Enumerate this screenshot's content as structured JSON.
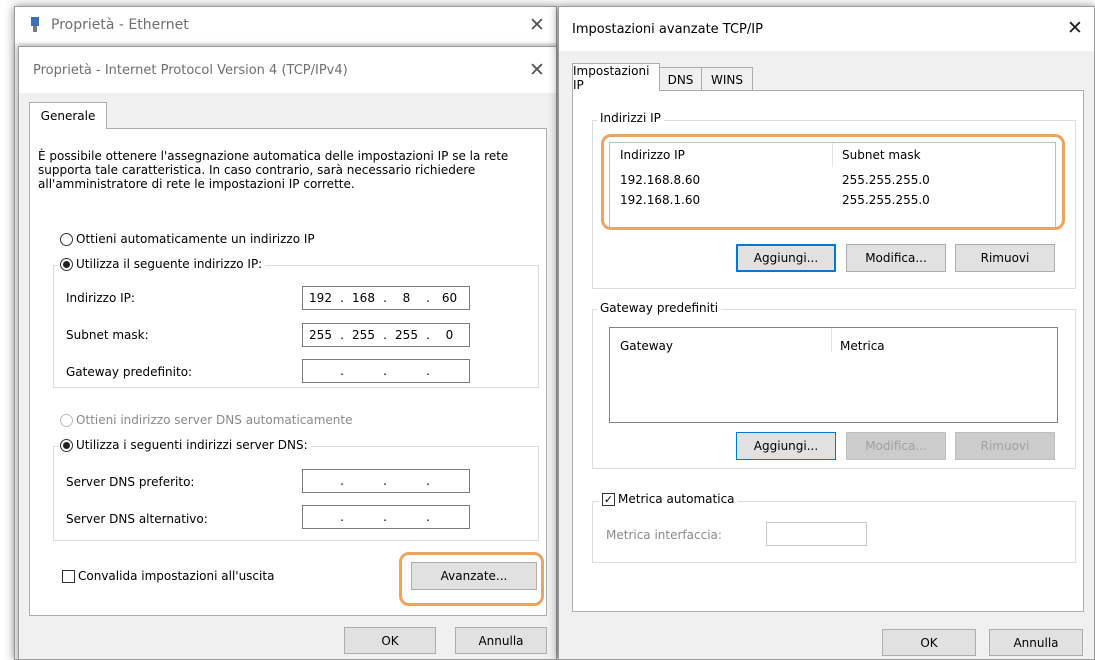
{
  "ethernet_window": {
    "title": "Proprietà - Ethernet"
  },
  "ipv4_dialog": {
    "title": "Proprietà - Internet Protocol Version 4 (TCP/IPv4)",
    "tab_general": "Generale",
    "description": "È possibile ottenere l'assegnazione automatica delle impostazioni IP se la rete supporta tale caratteristica. In caso contrario, sarà necessario richiedere all'amministratore di rete le impostazioni IP corrette.",
    "radio_auto_ip": "Ottieni automaticamente un indirizzo IP",
    "radio_manual_ip": "Utilizza il seguente indirizzo IP:",
    "ip_address_label": "Indirizzo IP:",
    "ip_address": [
      "192",
      "168",
      "8",
      "60"
    ],
    "subnet_label": "Subnet mask:",
    "subnet": [
      "255",
      "255",
      "255",
      "0"
    ],
    "gateway_label": "Gateway predefinito:",
    "gateway": [
      "",
      "",
      "",
      ""
    ],
    "radio_auto_dns": "Ottieni indirizzo server DNS automaticamente",
    "radio_manual_dns": "Utilizza i seguenti indirizzi server DNS:",
    "dns_preferred_label": "Server DNS preferito:",
    "dns_preferred": [
      "",
      "",
      "",
      ""
    ],
    "dns_alternate_label": "Server DNS alternativo:",
    "dns_alternate": [
      "",
      "",
      "",
      ""
    ],
    "validate_checkbox": "Convalida impostazioni all'uscita",
    "advanced_button": "Avanzate...",
    "ok_button": "OK",
    "cancel_button": "Annulla"
  },
  "advanced_dialog": {
    "title": "Impostazioni avanzate TCP/IP",
    "tabs": [
      "Impostazioni IP",
      "DNS",
      "WINS"
    ],
    "ip_group_label": "Indirizzi IP",
    "ip_columns": [
      "Indirizzo IP",
      "Subnet mask"
    ],
    "ip_rows": [
      {
        "ip": "192.168.8.60",
        "mask": "255.255.255.0"
      },
      {
        "ip": "192.168.1.60",
        "mask": "255.255.255.0"
      }
    ],
    "ip_add": "Aggiungi...",
    "ip_edit": "Modifica...",
    "ip_remove": "Rimuovi",
    "gateway_group_label": "Gateway predefiniti",
    "gateway_columns": [
      "Gateway",
      "Metrica"
    ],
    "gw_add": "Aggiungi...",
    "gw_edit": "Modifica...",
    "gw_remove": "Rimuovi",
    "auto_metric_label": "Metrica automatica",
    "auto_metric_checked": true,
    "interface_metric_label": "Metrica interfaccia:",
    "interface_metric_value": "",
    "ok_button": "OK",
    "cancel_button": "Annulla"
  },
  "colors": {
    "highlight": "#f0a35e",
    "focus": "#0078d7"
  }
}
